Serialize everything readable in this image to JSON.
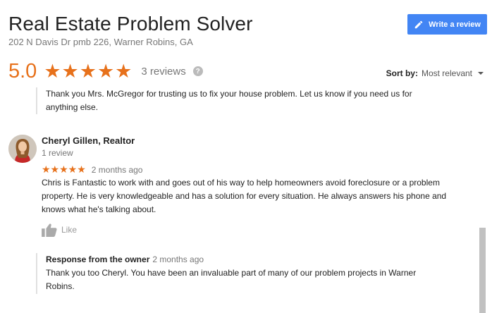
{
  "header": {
    "title": "Real Estate Problem Solver",
    "address": "202 N Davis Dr pmb 226, Warner Robins, GA",
    "write_review_label": "Write a review"
  },
  "rating": {
    "score": "5.0",
    "stars": "★★★★★",
    "stars_value": 5,
    "reviews_label": "3 reviews",
    "help_glyph": "?"
  },
  "sort": {
    "label": "Sort by:",
    "value": "Most relevant"
  },
  "previous_reply": {
    "text": "Thank you Mrs. McGregor for trusting us to fix your house problem. Let us know if you need us for anything else."
  },
  "review": {
    "name": "Cheryl Gillen, Realtor",
    "review_count": "1 review",
    "stars": "★★★★★",
    "stars_value": 5,
    "date": "2 months ago",
    "text": "Chris is Fantastic to work with and goes out of his way to help homeowners avoid foreclosure or a problem property.  He is very knowledgeable and has a solution for every situation.  He always answers his phone and knows what he's talking about.",
    "like_label": "Like",
    "owner_response": {
      "heading": "Response from the owner",
      "date": "2 months ago",
      "text": "Thank you too Cheryl. You have been an invaluable part of many of our problem projects in Warner Robins."
    }
  },
  "colors": {
    "accent_star": "#e7711b",
    "button_blue": "#4285f4",
    "muted_text": "#777777"
  },
  "icons": {
    "write": "pencil-icon",
    "help": "help-circle-icon",
    "sort": "caret-down-icon",
    "like": "thumbs-up-icon"
  }
}
